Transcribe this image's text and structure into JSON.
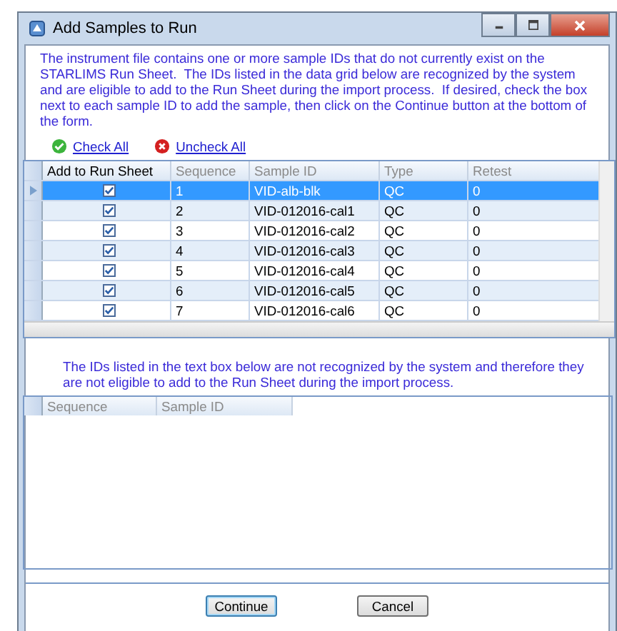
{
  "window": {
    "title": "Add Samples to Run"
  },
  "intro": "The instrument file contains one or more sample IDs that do not currently exist on the STARLIMS Run Sheet.  The IDs listed in the data grid below are recognized by the system and are eligible to add to the Run Sheet during the import process.  If desired, check the box next to each sample ID to add the sample, then click on the Continue button at the bottom of the form.",
  "links": [
    {
      "kind": "check",
      "label": "Check All"
    },
    {
      "kind": "uncheck",
      "label": "Uncheck All"
    }
  ],
  "grid": {
    "columns": [
      "Add to Run Sheet",
      "Sequence",
      "Sample ID",
      "Type",
      "Retest"
    ],
    "rows": [
      {
        "selected": true,
        "checked": true,
        "sequence": "1",
        "sample_id": "VID-alb-blk",
        "type": "QC",
        "retest": "0"
      },
      {
        "selected": false,
        "checked": true,
        "sequence": "2",
        "sample_id": "VID-012016-cal1",
        "type": "QC",
        "retest": "0"
      },
      {
        "selected": false,
        "checked": true,
        "sequence": "3",
        "sample_id": "VID-012016-cal2",
        "type": "QC",
        "retest": "0"
      },
      {
        "selected": false,
        "checked": true,
        "sequence": "4",
        "sample_id": "VID-012016-cal3",
        "type": "QC",
        "retest": "0"
      },
      {
        "selected": false,
        "checked": true,
        "sequence": "5",
        "sample_id": "VID-012016-cal4",
        "type": "QC",
        "retest": "0"
      },
      {
        "selected": false,
        "checked": true,
        "sequence": "6",
        "sample_id": "VID-012016-cal5",
        "type": "QC",
        "retest": "0"
      },
      {
        "selected": false,
        "checked": true,
        "sequence": "7",
        "sample_id": "VID-012016-cal6",
        "type": "QC",
        "retest": "0"
      }
    ]
  },
  "note": "The IDs listed in the text box below are not recognized by the system and therefore they are not eligible to add to the Run Sheet during the import process.",
  "unrecognized": {
    "columns": [
      "Sequence",
      "Sample ID"
    ]
  },
  "buttons": [
    {
      "label": "Continue",
      "selected": true
    },
    {
      "label": "Cancel",
      "selected": false
    }
  ]
}
